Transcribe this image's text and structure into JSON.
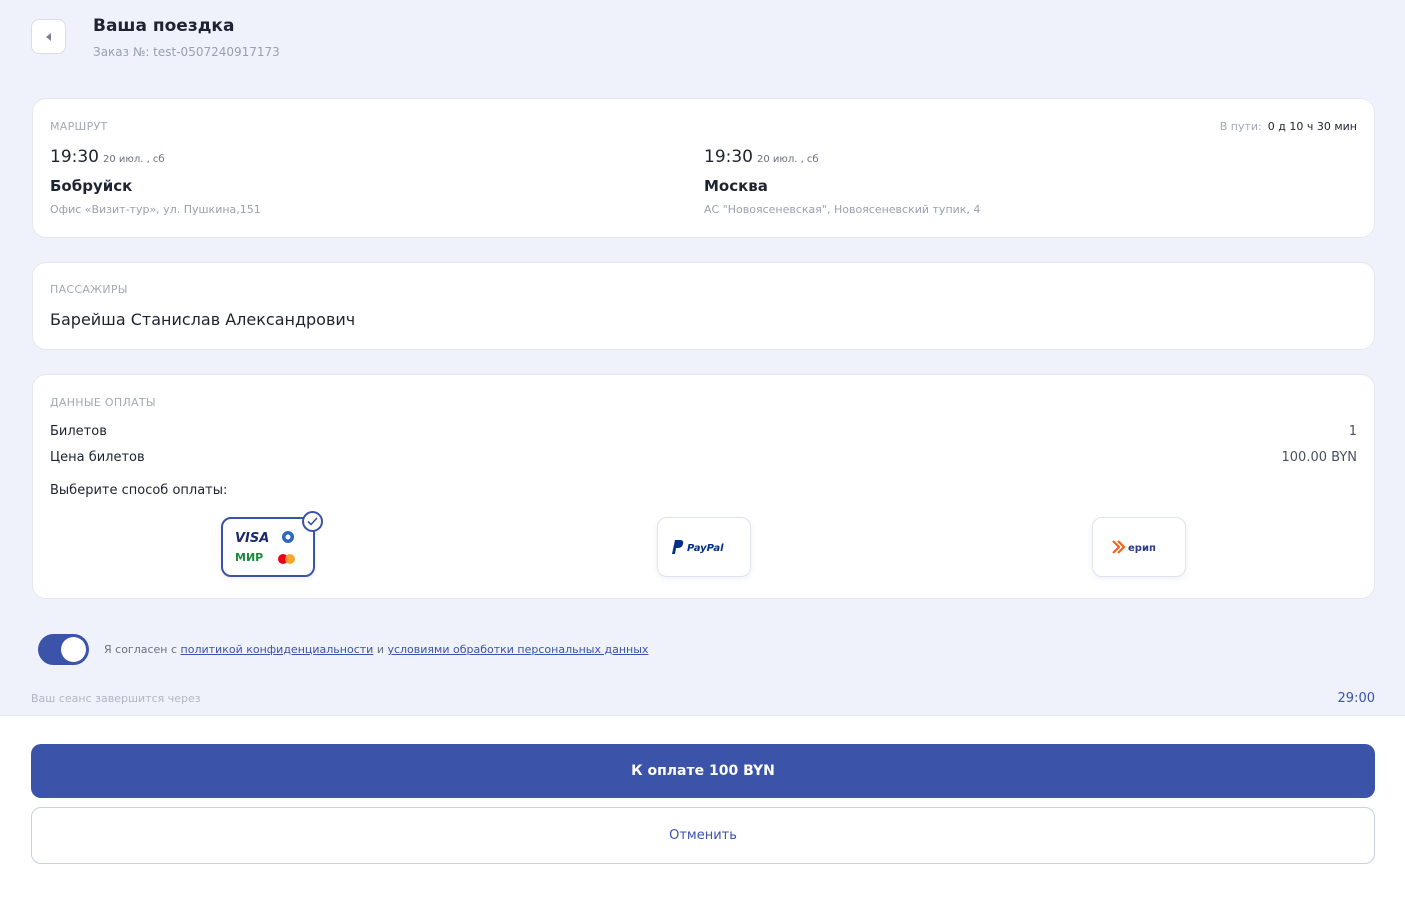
{
  "header": {
    "title": "Ваша поездка",
    "order_number": "Заказ №: test-0507240917173"
  },
  "route": {
    "label": "МАРШРУТ",
    "duration_label": "В пути:",
    "duration_value": "0 д 10 ч 30 мин",
    "departure": {
      "time": "19:30",
      "date": "20 июл. , сб",
      "city": "Бобруйск",
      "address": "Офис «Визит-тур», ул. Пушкина,151"
    },
    "arrival": {
      "time": "19:30",
      "date": "20 июл. , сб",
      "city": "Москва",
      "address": "АС \"Новоясеневская\", Новоясеневский тупик, 4"
    }
  },
  "passengers": {
    "label": "ПАССАЖИРЫ",
    "name": "Барейша Станислав Александрович"
  },
  "payment": {
    "label": "ДАННЫЕ ОПЛАТЫ",
    "tickets_label": "Билетов",
    "tickets_value": "1",
    "price_label": "Цена билетов",
    "price_value": "100.00 BYN",
    "choose_label": "Выберите способ оплаты:",
    "methods": [
      {
        "name": "cards",
        "text_visa": "VISA",
        "text_mir": "МИР",
        "selected": true
      },
      {
        "name": "paypal",
        "text": "PayPal",
        "selected": false
      },
      {
        "name": "erip",
        "text": "ерип",
        "selected": false
      }
    ]
  },
  "consent": {
    "enabled": true,
    "prefix": "Я согласен с",
    "link1": "политикой конфиденциальности",
    "middle": "и",
    "link2": "условиями обработки персональных данных"
  },
  "session": {
    "text": "Ваш сеанс завершится через",
    "timer": "29:00"
  },
  "actions": {
    "pay_label": "К оплате 100 BYN",
    "cancel_label": "Отменить"
  },
  "colors": {
    "accent": "#3b53a8",
    "background": "#eff2fb"
  }
}
